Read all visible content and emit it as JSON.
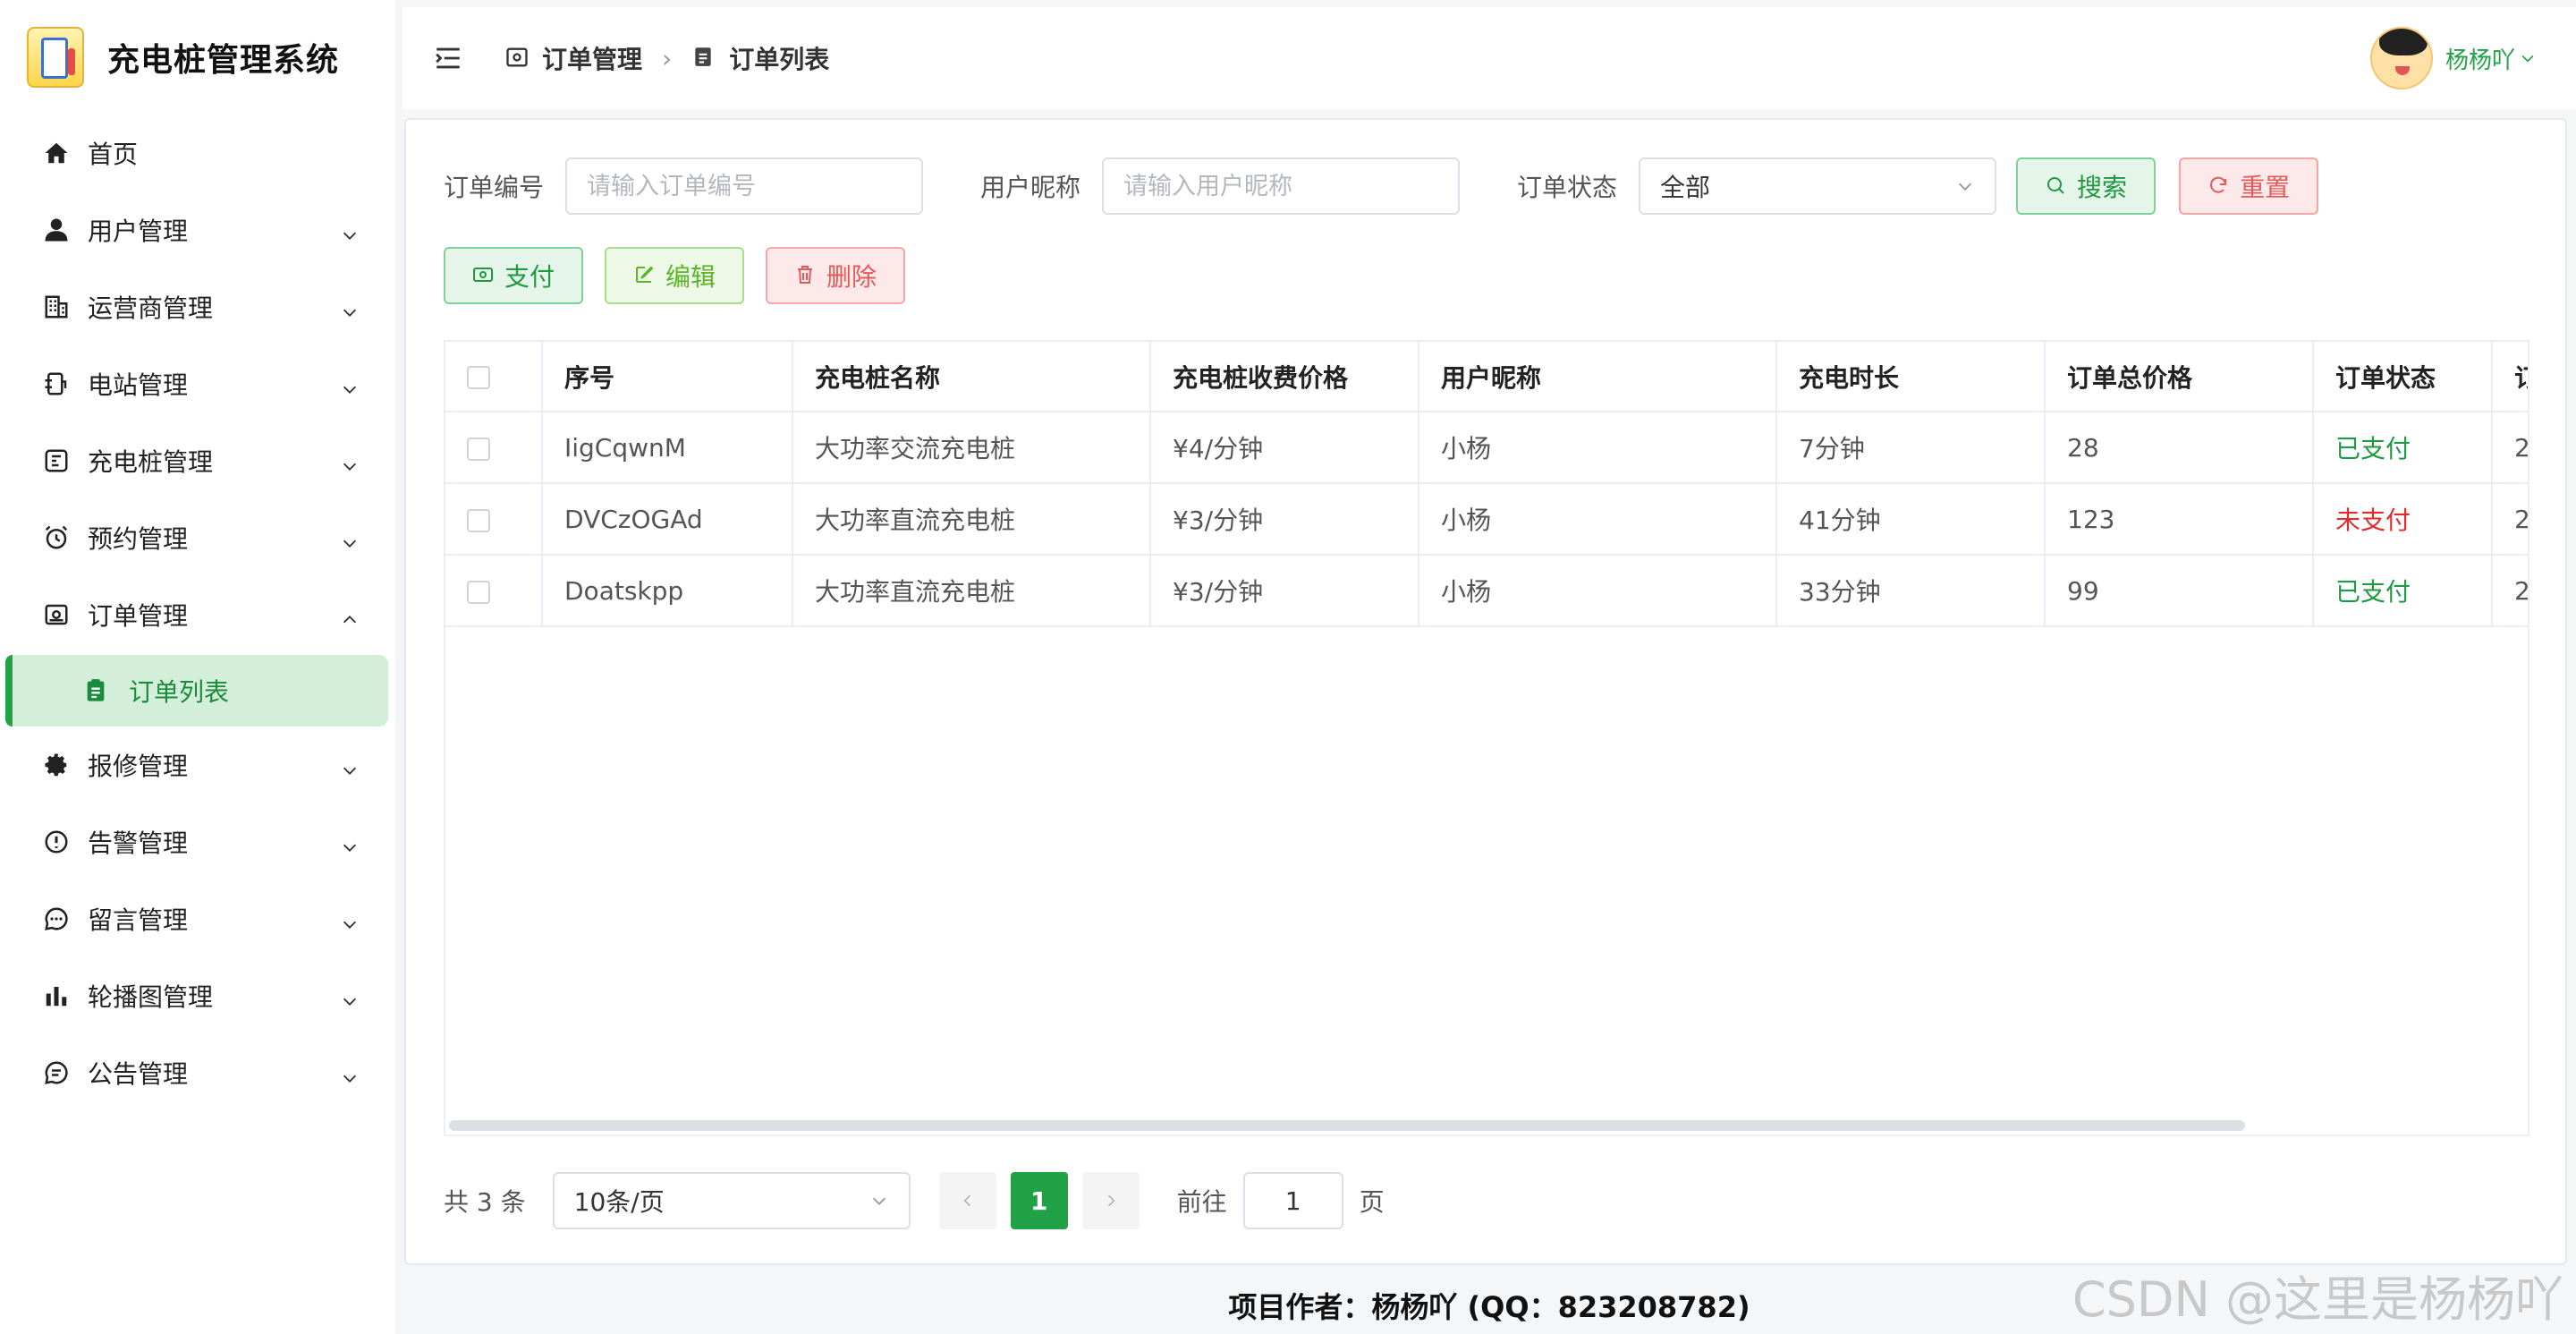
{
  "app": {
    "title": "充电桩管理系统"
  },
  "sidebar": {
    "items": [
      {
        "label": "首页",
        "icon": "home-icon",
        "expandable": false
      },
      {
        "label": "用户管理",
        "icon": "user-icon",
        "expandable": true
      },
      {
        "label": "运营商管理",
        "icon": "building-icon",
        "expandable": true
      },
      {
        "label": "电站管理",
        "icon": "station-icon",
        "expandable": true
      },
      {
        "label": "充电桩管理",
        "icon": "charger-icon",
        "expandable": true
      },
      {
        "label": "预约管理",
        "icon": "alarm-clock-icon",
        "expandable": true
      },
      {
        "label": "订单管理",
        "icon": "order-icon",
        "expandable": true,
        "expanded": true
      },
      {
        "label": "报修管理",
        "icon": "gear-icon",
        "expandable": true
      },
      {
        "label": "告警管理",
        "icon": "warning-icon",
        "expandable": true
      },
      {
        "label": "留言管理",
        "icon": "chat-icon",
        "expandable": true
      },
      {
        "label": "轮播图管理",
        "icon": "bar-chart-icon",
        "expandable": true
      },
      {
        "label": "公告管理",
        "icon": "message-icon",
        "expandable": true
      }
    ],
    "active_sub": {
      "label": "订单列表",
      "icon": "clipboard-icon"
    }
  },
  "header": {
    "breadcrumb": [
      "订单管理",
      "订单列表"
    ],
    "user_name": "杨杨吖"
  },
  "filters": {
    "order_no_label": "订单编号",
    "order_no_placeholder": "请输入订单编号",
    "nickname_label": "用户昵称",
    "nickname_placeholder": "请输入用户昵称",
    "status_label": "订单状态",
    "status_value": "全部",
    "search_label": "搜索",
    "reset_label": "重置"
  },
  "actions": {
    "pay": "支付",
    "edit": "编辑",
    "delete": "删除"
  },
  "table": {
    "columns": [
      "序号",
      "充电桩名称",
      "充电桩收费价格",
      "用户昵称",
      "充电时长",
      "订单总价格",
      "订单状态",
      "订"
    ],
    "rows": [
      {
        "id": "IigCqwnM",
        "name": "大功率交流充电桩",
        "price": "¥4/分钟",
        "user": "小杨",
        "duration": "7分钟",
        "total": "28",
        "status": "已支付",
        "paid": true,
        "extra": "2"
      },
      {
        "id": "DVCzOGAd",
        "name": "大功率直流充电桩",
        "price": "¥3/分钟",
        "user": "小杨",
        "duration": "41分钟",
        "total": "123",
        "status": "未支付",
        "paid": false,
        "extra": "2"
      },
      {
        "id": "Doatskpp",
        "name": "大功率直流充电桩",
        "price": "¥3/分钟",
        "user": "小杨",
        "duration": "33分钟",
        "total": "99",
        "status": "已支付",
        "paid": true,
        "extra": "2"
      }
    ]
  },
  "pagination": {
    "total_text": "共 3 条",
    "page_size": "10条/页",
    "current_page": "1",
    "goto_label": "前往",
    "goto_value": "1",
    "page_unit": "页"
  },
  "footer": {
    "text": "项目作者：杨杨吖 (QQ：823208782)"
  },
  "watermark": "CSDN @这里是杨杨吖",
  "colors": {
    "accent": "#22a246",
    "danger": "#e22c2c",
    "active_bg": "#d4efd9"
  }
}
